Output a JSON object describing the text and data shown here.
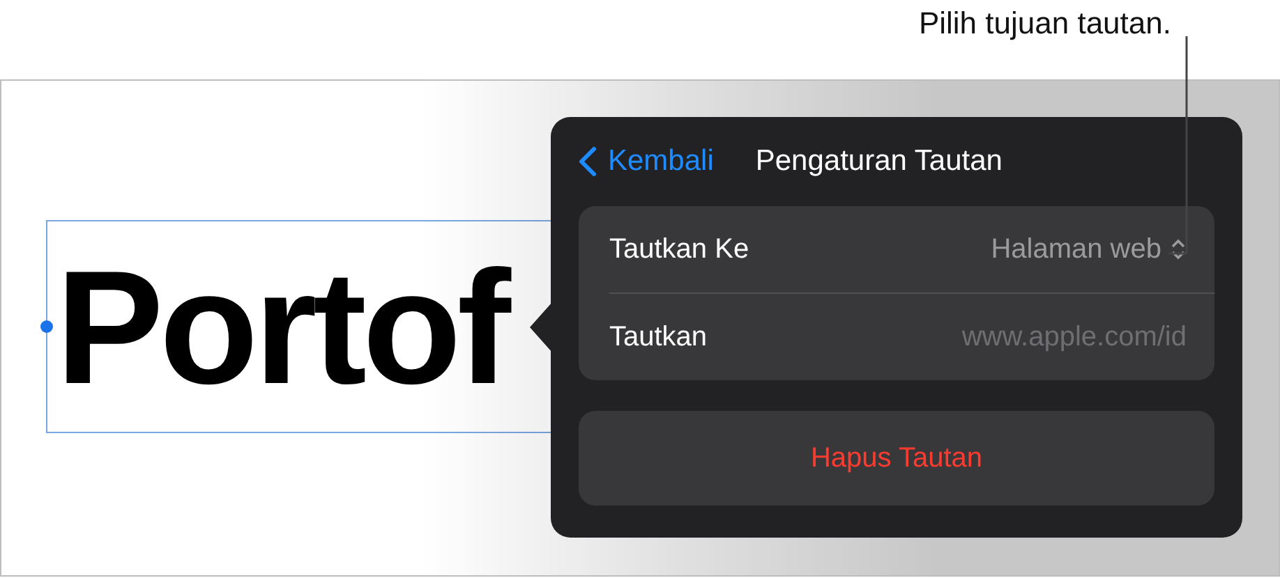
{
  "callout": {
    "text": "Pilih tujuan tautan."
  },
  "canvas": {
    "text_box": {
      "text": "Portof",
      "selected": true
    }
  },
  "popover": {
    "back": "Kembali",
    "title": "Pengaturan Tautan",
    "rows": [
      {
        "kind": "picker",
        "label": "Tautkan Ke",
        "value": "Halaman web"
      },
      {
        "kind": "field",
        "label": "Tautkan",
        "placeholder": "www.apple.com/id"
      }
    ],
    "action": "Hapus Tautan"
  }
}
